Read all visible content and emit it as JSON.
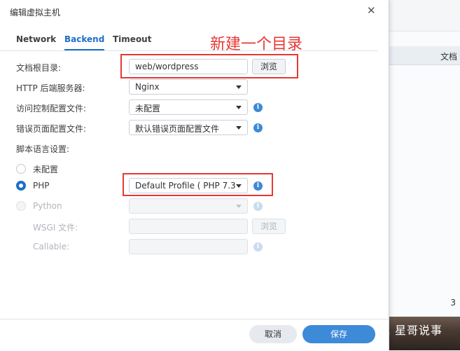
{
  "dialog": {
    "title": "编辑虚拟主机",
    "close_glyph": "✕"
  },
  "tabs": [
    {
      "label": "Network",
      "active": false
    },
    {
      "label": "Backend",
      "active": true
    },
    {
      "label": "Timeout",
      "active": false
    }
  ],
  "annotation": "新建一个目录",
  "form": {
    "doc_root": {
      "label": "文档根目录:",
      "value": "web/wordpress",
      "browse_label": "浏览"
    },
    "http_server": {
      "label": "HTTP 后端服务器:",
      "value": "Nginx"
    },
    "access_control": {
      "label": "访问控制配置文件:",
      "value": "未配置"
    },
    "error_page": {
      "label": "错误页面配置文件:",
      "value": "默认错误页面配置文件"
    },
    "script_lang": {
      "label": "脚本语言设置:"
    },
    "radios": [
      {
        "label": "未配置",
        "checked": false,
        "disabled": false
      },
      {
        "label": "PHP",
        "checked": true,
        "disabled": false
      },
      {
        "label": "Python",
        "checked": false,
        "disabled": true
      }
    ],
    "php_profile": {
      "value": "Default Profile ( PHP 7.3"
    },
    "python_profile": {
      "value": ""
    },
    "wsgi": {
      "label": "WSGI 文件:",
      "value": "",
      "browse_label": "浏览"
    },
    "callable": {
      "label": "Callable:",
      "value": ""
    },
    "info_glyph": "i"
  },
  "footer": {
    "cancel_label": "取消",
    "save_label": "保存"
  },
  "background": {
    "header_text": "文档",
    "count": "3"
  },
  "watermark": {
    "text": "星哥说事",
    "icon_glyph": "☁"
  },
  "colors": {
    "accent": "#1d6fc8",
    "annotation_red": "#e53935",
    "save_button": "#3d8ad8"
  }
}
